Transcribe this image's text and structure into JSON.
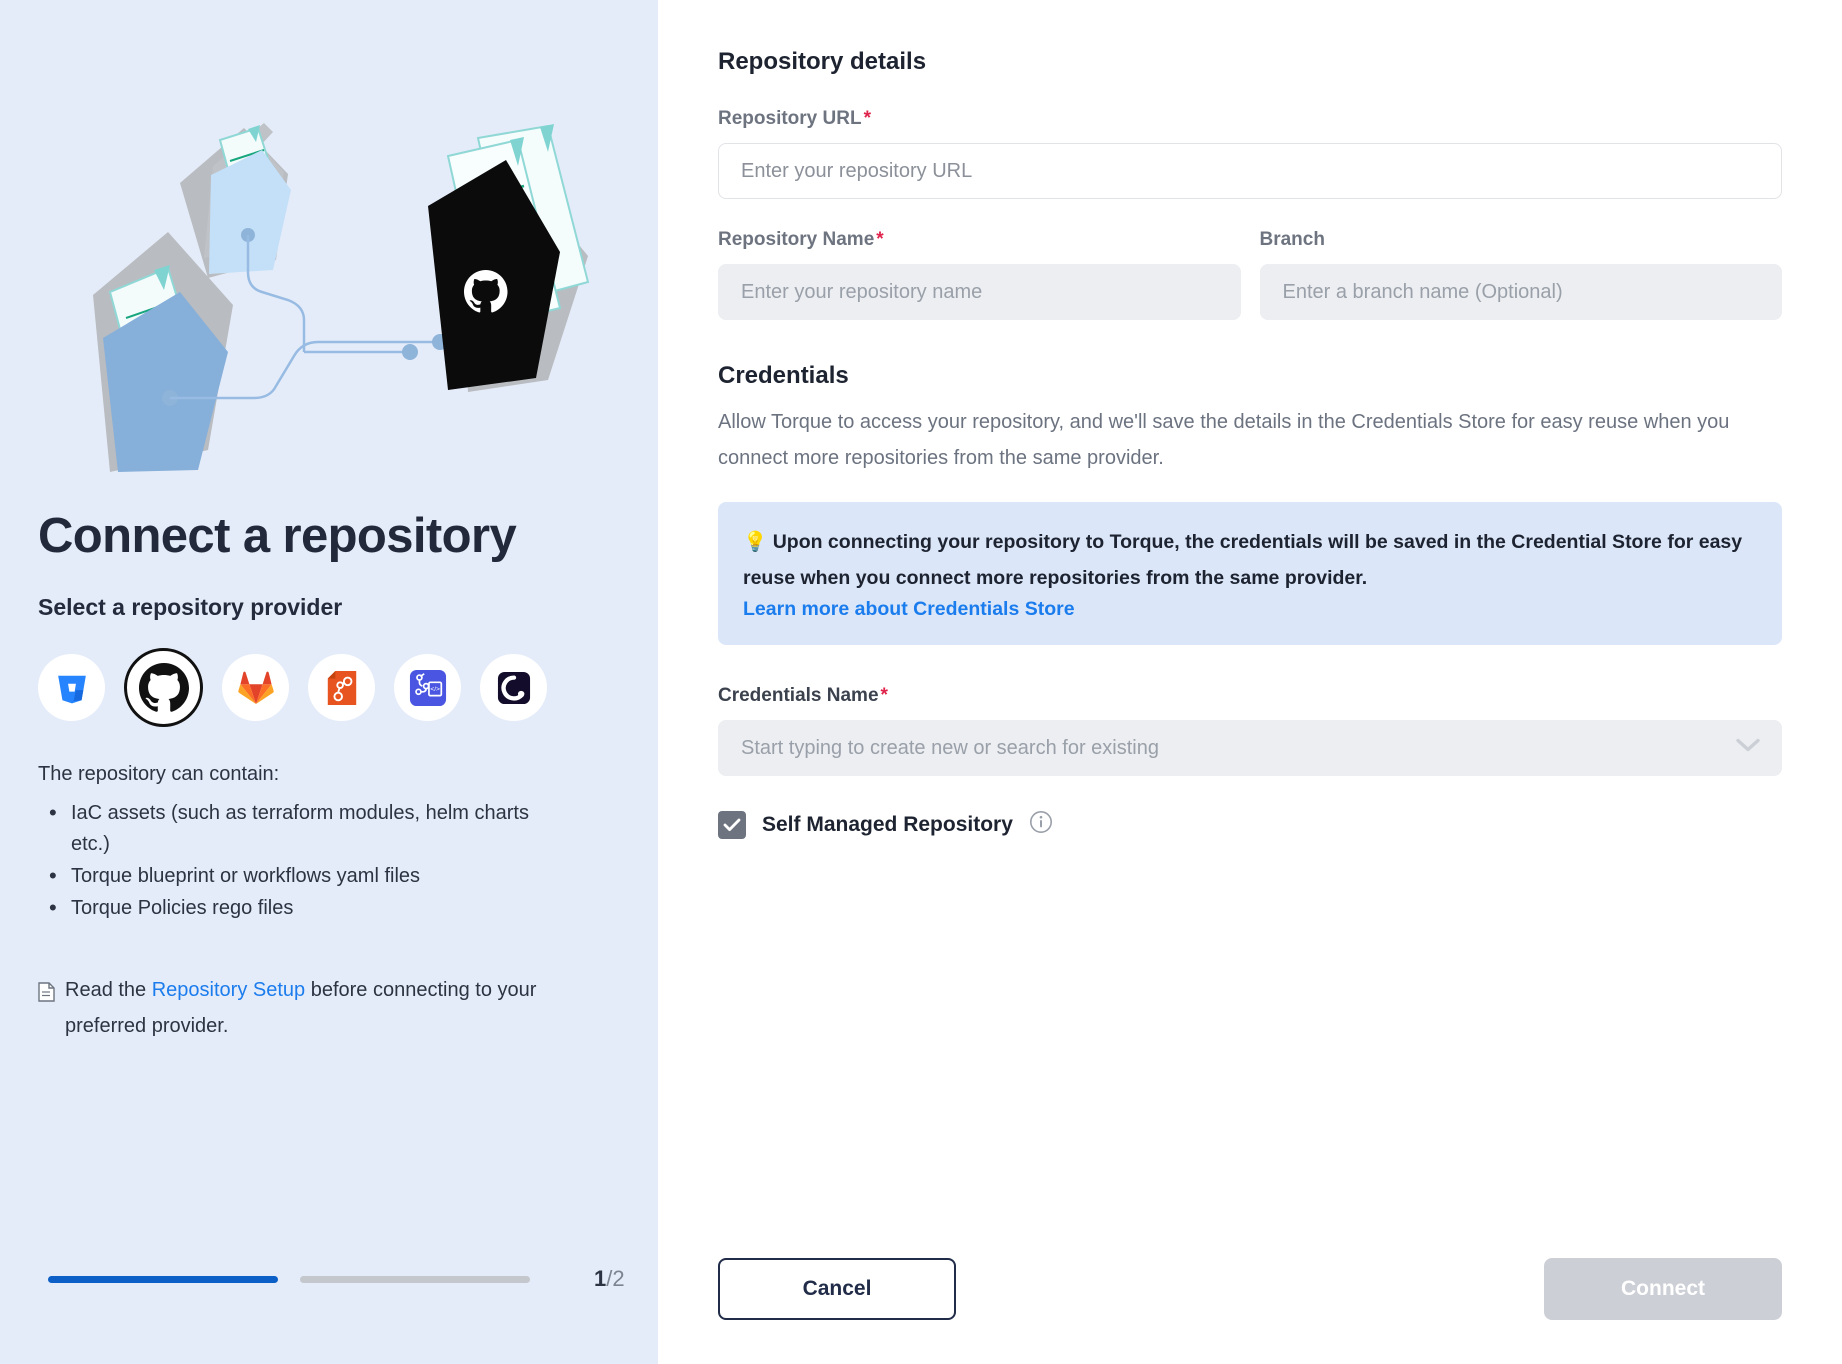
{
  "left": {
    "illustration_name": "repository-connection-illustration",
    "headline": "Connect a repository",
    "subhead": "Select a repository provider",
    "providers": [
      {
        "id": "bitbucket",
        "name": "bitbucket-icon",
        "selected": false
      },
      {
        "id": "github",
        "name": "github-icon",
        "selected": true
      },
      {
        "id": "gitlab",
        "name": "gitlab-icon",
        "selected": false
      },
      {
        "id": "codecommit",
        "name": "codecommit-icon",
        "selected": false
      },
      {
        "id": "azure-devops",
        "name": "azure-devops-icon",
        "selected": false
      },
      {
        "id": "quali",
        "name": "quali-icon",
        "selected": false
      }
    ],
    "contain_label": "The repository can contain:",
    "contain_items": [
      "IaC assets (such as terraform modules, helm charts etc.)",
      "Torque blueprint or workflows yaml files",
      "Torque Policies rego files"
    ],
    "read_note": {
      "before": "Read the ",
      "link": "Repository Setup",
      "after": " before connecting to your preferred provider."
    },
    "progress": {
      "current_step": "1",
      "total_steps": "/2",
      "steps_done": 1,
      "steps_total": 2
    }
  },
  "right": {
    "section_title": "Repository details",
    "fields": {
      "repository_url": {
        "label": "Repository URL",
        "required": true,
        "value": "",
        "placeholder": "Enter your repository URL"
      },
      "repository_name": {
        "label": "Repository Name",
        "required": true,
        "value": "",
        "placeholder": "Enter your repository name"
      },
      "branch": {
        "label": "Branch",
        "required": false,
        "value": "",
        "placeholder": "Enter a branch name (Optional)"
      },
      "credentials_name": {
        "label": "Credentials Name",
        "required": true,
        "value": "",
        "placeholder": "Start typing to create new or search for existing"
      }
    },
    "credentials": {
      "title": "Credentials",
      "description": "Allow Torque to access your repository, and we'll save the details in the Credentials Store for easy reuse when you connect more repositories from the same provider.",
      "callout": {
        "emoji": "💡",
        "text": "Upon connecting your repository to Torque, the credentials will be saved in the Credential Store for easy reuse when you connect more repositories from the same provider.",
        "link": "Learn more about Credentials Store"
      }
    },
    "self_managed": {
      "label": "Self Managed Repository",
      "checked": true
    },
    "footer": {
      "cancel_label": "Cancel",
      "connect_label": "Connect",
      "connect_disabled": true
    }
  },
  "colors": {
    "left_bg": "#e5ecf9",
    "accent_blue": "#1b7ced",
    "progress_done": "#0b5fc7",
    "progress_todo": "#c4c7cc",
    "required_red": "#e0234b",
    "callout_bg": "#dbe7f8",
    "cancel_border": "#212c49",
    "connect_disabled_bg": "#ccd0d6"
  }
}
